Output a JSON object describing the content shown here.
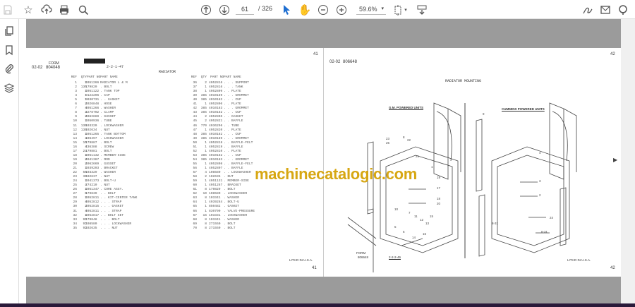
{
  "toolbar": {
    "page_current": "61",
    "page_total": "/ 326",
    "zoom": "59.6%",
    "icons": [
      "save-icon",
      "bookmark-star-icon",
      "upload-icon",
      "print-icon",
      "find-icon",
      "page-up-icon",
      "page-down-icon",
      "select-cursor-icon",
      "hand-icon",
      "zoom-out-icon",
      "zoom-in-icon",
      "fit-page-icon",
      "scroll-mode-icon",
      "sign-icon",
      "mail-icon",
      "account-icon"
    ]
  },
  "sidebar": {
    "icons": [
      "page-thumbnails-icon",
      "bookmarks-icon",
      "attachments-icon",
      "layers-icon"
    ]
  },
  "left_page": {
    "form_label": "FORM",
    "form_no": "804048",
    "section": "02-02",
    "date": "2-2-1-47",
    "title": "RADIATOR",
    "page_no": "41",
    "footer": "LITHO IN U.S.A.",
    "headers": {
      "ref": "REF",
      "qty": "QTY",
      "part_no": "PART NO",
      "part_name": "PART NAME"
    },
    "rows_a": [
      [
        "1",
        "1",
        "4051266",
        "RADIATOR L & M"
      ],
      [
        "2",
        "136",
        "179820",
        ". BOLT"
      ],
      [
        "3",
        "1",
        "4051122",
        ". TANK TOP"
      ],
      [
        "4",
        "1",
        "9122296",
        ". CAP"
      ],
      [
        "5",
        "1",
        "9030731",
        ". . GASKET"
      ],
      [
        "6",
        "2",
        "4026848",
        ". HOSE"
      ],
      [
        "7",
        "4",
        "4051266",
        ". WASHER"
      ],
      [
        "8",
        "4",
        "2278702",
        ". CLAMP"
      ],
      [
        "9",
        "2",
        "4062669",
        ". GUSSET"
      ],
      [
        "10",
        "1",
        "4050936",
        ". TUBE"
      ],
      [
        "11",
        "138",
        "103320",
        ". LOCKWASHER"
      ],
      [
        "12",
        "138",
        "102634",
        ". NUT"
      ],
      [
        "13",
        "1",
        "4051265",
        ". TANK BOTTOM"
      ],
      [
        "14",
        "4",
        "106497",
        ". LOCKWASHER"
      ],
      [
        "15",
        "10",
        "179887",
        ". BOLT"
      ],
      [
        "16",
        "4",
        "436388",
        ". SCREW"
      ],
      [
        "17",
        "24",
        "179881",
        ". BOLT"
      ],
      [
        "18",
        "1",
        "4051132",
        ". MEMBER-SIDE"
      ],
      [
        "19",
        "2",
        "4041367",
        ". ROD"
      ],
      [
        "20",
        "2",
        "4062669",
        ". GUSSET"
      ],
      [
        "21",
        "1",
        "4039203",
        ". BRACKET"
      ],
      [
        "22",
        "56",
        "103329",
        ". WASHER"
      ],
      [
        "23",
        "32",
        "102637",
        ". NUT"
      ],
      [
        "24",
        "1",
        "4041373",
        ". BOLT-U"
      ],
      [
        "25",
        "4",
        "274210",
        ". NUT"
      ],
      [
        "26",
        "1",
        "4051347",
        ". CORE ASSY."
      ],
      [
        "27",
        "8",
        "179839",
        ". . BOLT"
      ],
      [
        "28",
        "1",
        "4052811",
        ". . KIT-CENTER TANK"
      ],
      [
        "29",
        "4",
        "4052812",
        ". . . STRAP"
      ],
      [
        "30",
        "2",
        "4052815",
        ". . . GASKET"
      ],
      [
        "31",
        "4",
        "4052811",
        ". . . STRAP"
      ],
      [
        "32",
        "1",
        "4052817",
        ". . BOLT SET"
      ],
      [
        "33",
        "92",
        "179848",
        ". . . BOLT"
      ],
      [
        "34",
        "92",
        "108580",
        ". . . LOCKWASHER"
      ],
      [
        "35",
        "92",
        "102635",
        ". . . NUT"
      ]
    ],
    "rows_b": [
      [
        "36",
        "2",
        "4052816",
        ". . . SUPPORT"
      ],
      [
        "37",
        "1",
        "4052816",
        ". . . TANK"
      ],
      [
        "38",
        "1",
        "4052809",
        ". . PLATE"
      ],
      [
        "39",
        "385",
        "4010189",
        ". . . GROMMET"
      ],
      [
        "40",
        "385",
        "4010182",
        ". . . CUP"
      ],
      [
        "41",
        "1",
        "4052806",
        ". . PLATE"
      ],
      [
        "42",
        "385",
        "4010183",
        ". . . GROMMET"
      ],
      [
        "43",
        "385",
        "4010182",
        ". . . CUP"
      ],
      [
        "44",
        "2",
        "4052805",
        ". . GASKET"
      ],
      [
        "45",
        "2",
        "4052821",
        ". . BAFFLE"
      ],
      [
        "46",
        "770",
        "4036296",
        ". . TUBE"
      ],
      [
        "47",
        "1",
        "4052820",
        ". . PLATE"
      ],
      [
        "48",
        "385",
        "4010182",
        ". . . CUP"
      ],
      [
        "49",
        "385",
        "4010189",
        ". . . GROMMET"
      ],
      [
        "50",
        "1",
        "4052818",
        ". . BAFFLE-FELT"
      ],
      [
        "51",
        "1",
        "4052819",
        ". . BAFFLE"
      ],
      [
        "52",
        "1",
        "4052810",
        ". . PLATE"
      ],
      [
        "53",
        "385",
        "4010182",
        ". . . CUP"
      ],
      [
        "54",
        "385",
        "4010183",
        ". . . GROMMET"
      ],
      [
        "55",
        "1",
        "4052808",
        ". . BAFFLE-FELT"
      ],
      [
        "56",
        "1",
        "4052807",
        ". . BAFFLE"
      ],
      [
        "57",
        "4",
        "108580",
        ". . LOCKWASHER"
      ],
      [
        "58",
        "2",
        "102635",
        ". NUT"
      ],
      [
        "59",
        "1",
        "4051131",
        ". MEMBER-SIDE"
      ],
      [
        "60",
        "1",
        "4051267",
        ". BRACKET"
      ],
      [
        "61",
        "8",
        "179829",
        ". BOLT"
      ],
      [
        "62",
        "10",
        "108580",
        ". LOCKWASHER"
      ],
      [
        "63",
        "8",
        "103341",
        ". WASHER"
      ],
      [
        "64",
        "1",
        "4039284",
        ". BOLT-U"
      ],
      [
        "65",
        "1",
        "850482",
        ". GASKET"
      ],
      [
        "66",
        "1",
        "830790",
        ". VALVE-PRESSURE"
      ],
      [
        "67",
        "16",
        "103331",
        ". LOCKWASHER"
      ],
      [
        "68",
        "8",
        "103341",
        ". WASHER"
      ],
      [
        "69",
        "8",
        "271550",
        ". BOLT"
      ],
      [
        "70",
        "8",
        "271550",
        ". BOLT"
      ]
    ]
  },
  "right_page": {
    "section": "02-02",
    "form_no": "806648",
    "title": "RADIATOR MOUNTING",
    "page_no": "42",
    "footer": "LITHO IN U.S.A.",
    "form_label": "FORM",
    "form_no_bottom": "806648",
    "date": "2-2-2-46",
    "gm_label": "G.M. POWERED UNITS",
    "cummins_label": "CUMMINS POWERED UNITS",
    "callouts": [
      "23",
      "25",
      "8",
      "22",
      "21",
      "1",
      "19",
      "17",
      "18",
      "15",
      "20",
      "16",
      "14",
      "6",
      "5",
      "7",
      "11",
      "12",
      "13",
      "10",
      "9",
      "4",
      "3",
      "2",
      "24",
      "8-31",
      "6-31"
    ]
  },
  "watermark": "machinecatalogic.com"
}
